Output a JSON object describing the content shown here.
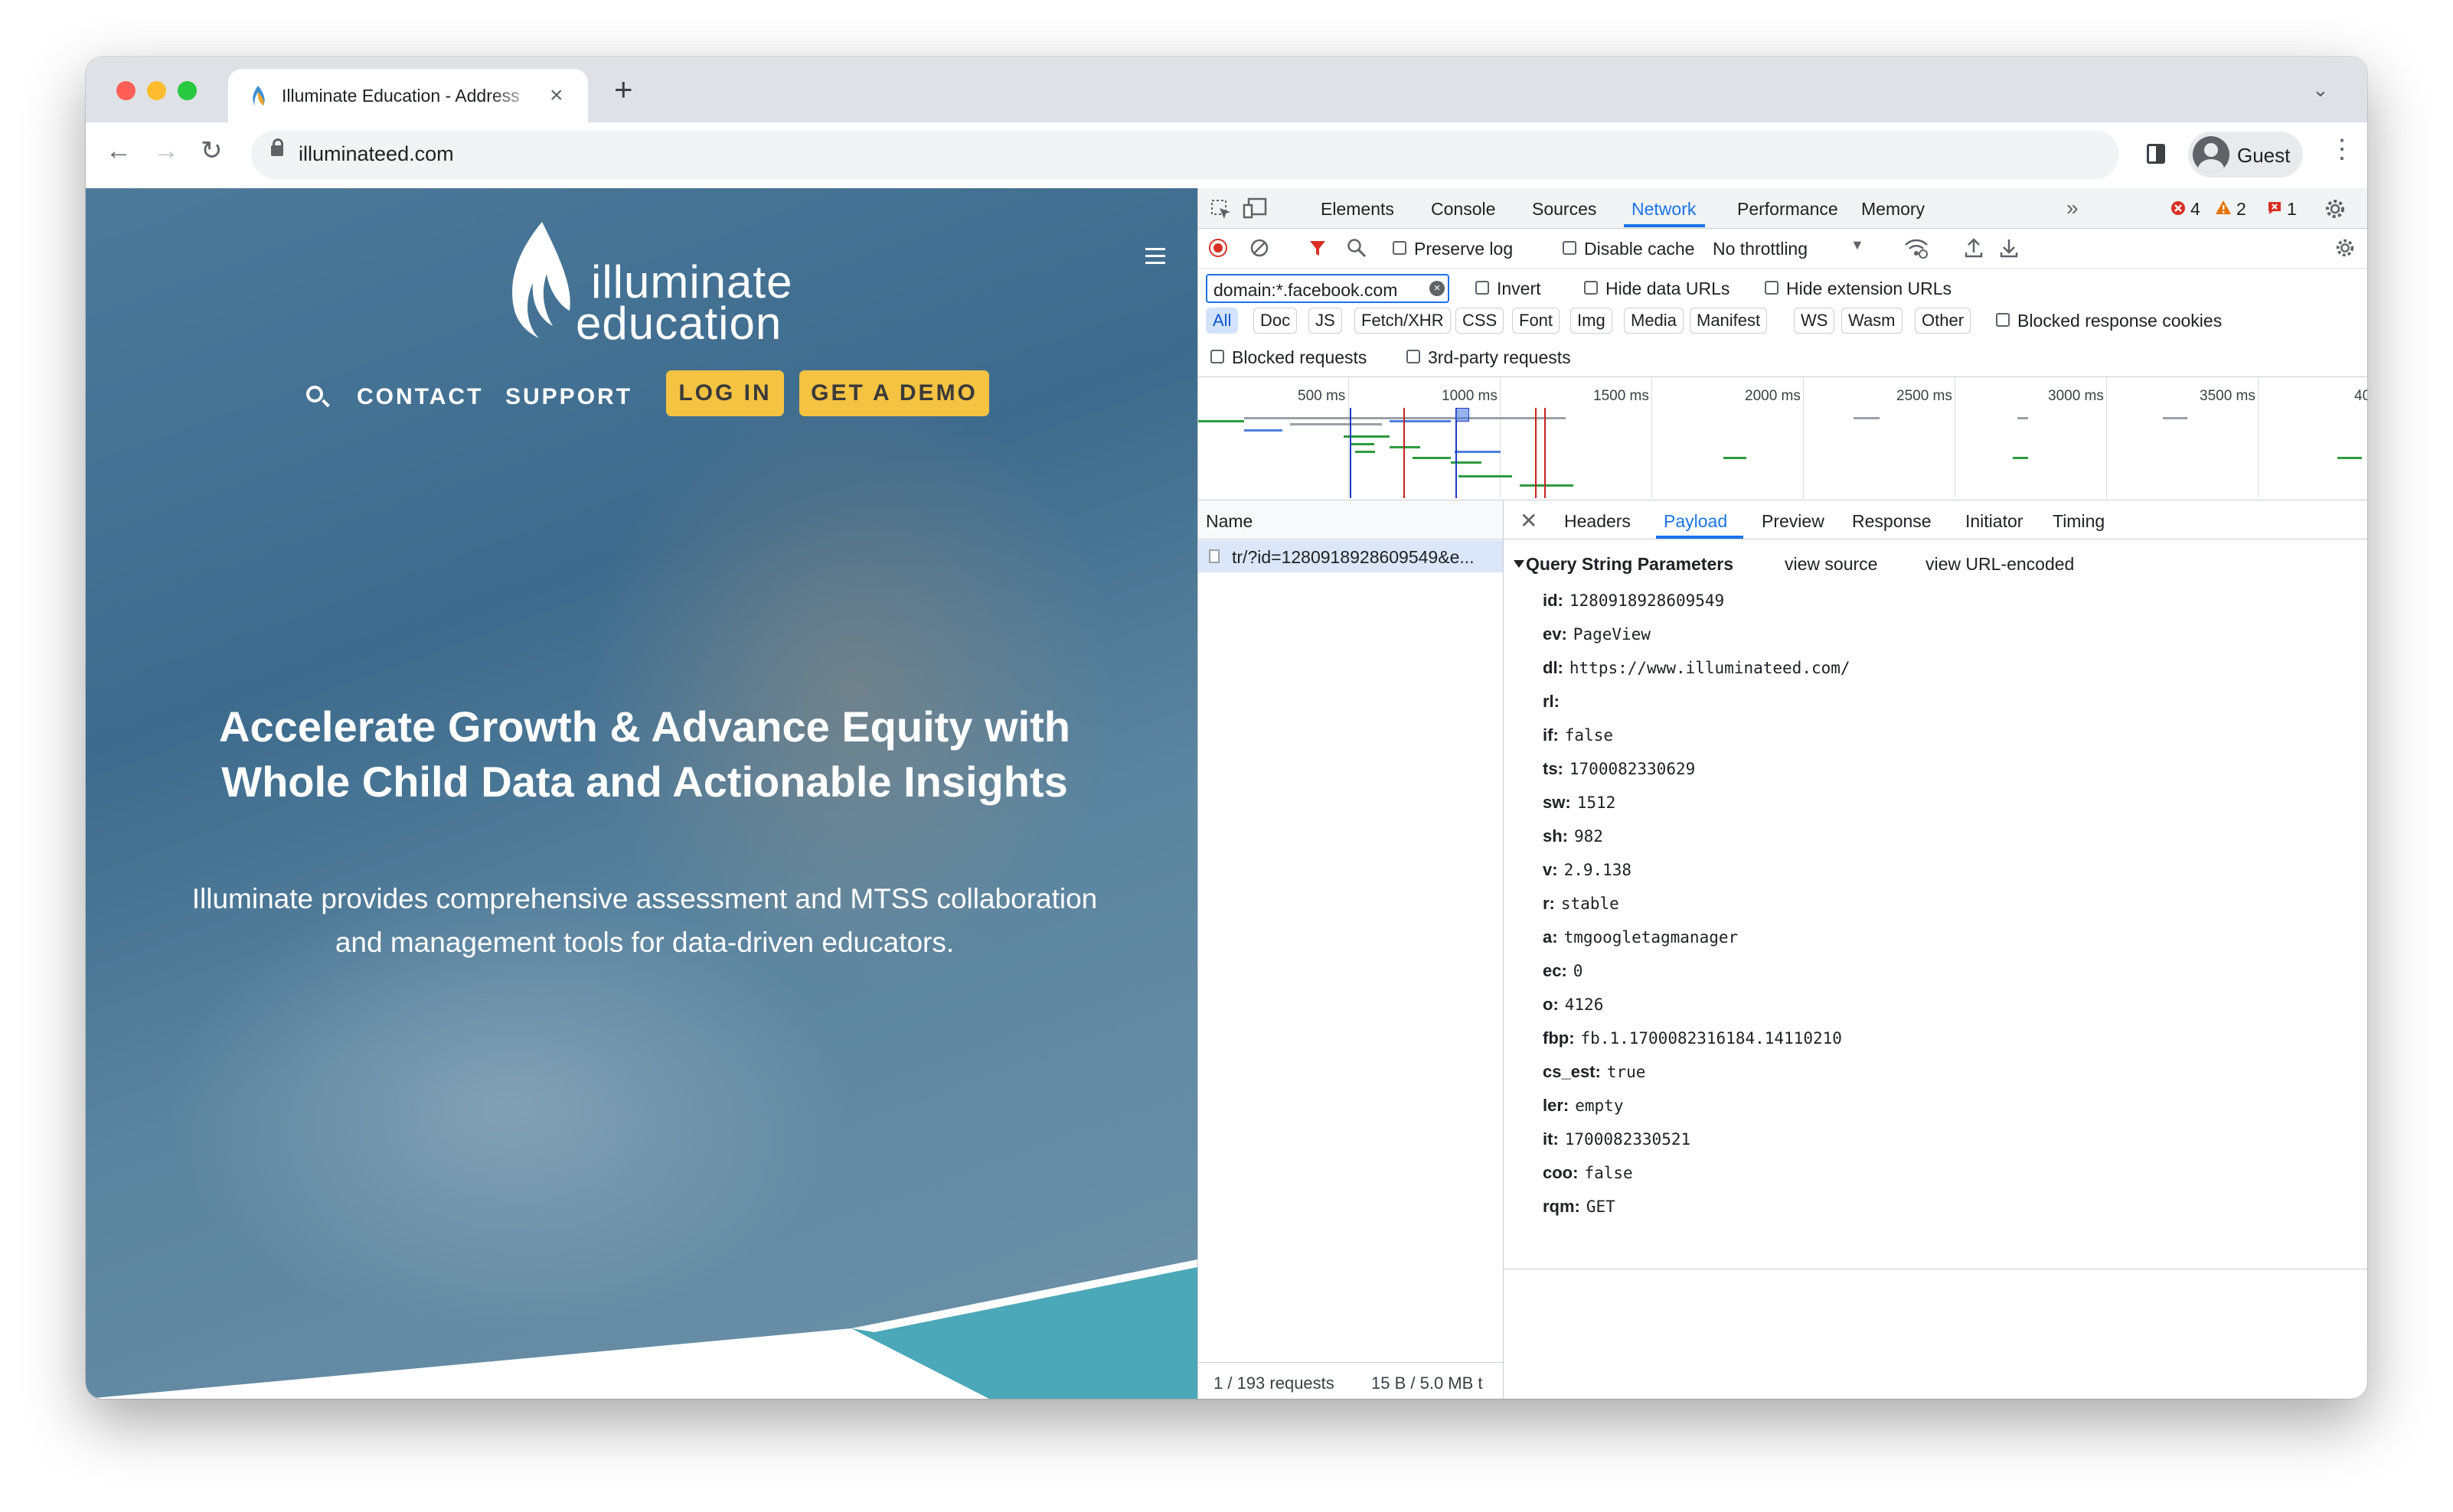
{
  "browser": {
    "tab_title": "Illuminate Education - Address",
    "url": "illuminateed.com",
    "profile_name": "Guest"
  },
  "website": {
    "logo_line1": "illuminate",
    "logo_line2": "education",
    "nav": {
      "contact": "CONTACT",
      "support": "SUPPORT",
      "login": "LOG IN",
      "demo": "GET A DEMO"
    },
    "headline_line1": "Accelerate Growth & Advance Equity with",
    "headline_line2": "Whole Child Data and Actionable Insights",
    "sub_line1": "Illuminate provides comprehensive assessment and MTSS collaboration",
    "sub_line2": "and management tools for data-driven educators.",
    "colors": {
      "accent_yellow": "#f5c342",
      "teal": "#4aa8b8"
    }
  },
  "devtools": {
    "tabs": [
      "Elements",
      "Console",
      "Sources",
      "Network",
      "Performance",
      "Memory"
    ],
    "active_tab": "Network",
    "errors": "4",
    "warnings": "2",
    "issues": "1",
    "toolbar": {
      "preserve_log": "Preserve log",
      "disable_cache": "Disable cache",
      "throttling": "No throttling"
    },
    "filter": {
      "value": "domain:*.facebook.com",
      "invert": "Invert",
      "hide_data_urls": "Hide data URLs",
      "hide_extension_urls": "Hide extension URLs"
    },
    "type_chips": [
      "All",
      "Doc",
      "JS",
      "Fetch/XHR",
      "CSS",
      "Font",
      "Img",
      "Media",
      "Manifest",
      "WS",
      "Wasm",
      "Other"
    ],
    "blocked_response_cookies": "Blocked response cookies",
    "blocked_requests": "Blocked requests",
    "third_party_requests": "3rd-party requests",
    "timeline_ticks": [
      "500 ms",
      "1000 ms",
      "1500 ms",
      "2000 ms",
      "2500 ms",
      "3000 ms",
      "3500 ms",
      "40"
    ],
    "name_header": "Name",
    "request_name": "tr/?id=1280918928609549&e...",
    "status": {
      "requests": "1 / 193 requests",
      "transferred": "15 B / 5.0 MB t"
    },
    "detail_tabs": [
      "Headers",
      "Payload",
      "Preview",
      "Response",
      "Initiator",
      "Timing"
    ],
    "active_detail_tab": "Payload",
    "qsp": {
      "title": "Query String Parameters",
      "view_source": "view source",
      "view_url_encoded": "view URL-encoded",
      "params": [
        {
          "key": "id:",
          "value": "1280918928609549"
        },
        {
          "key": "ev:",
          "value": "PageView"
        },
        {
          "key": "dl:",
          "value": "https://www.illuminateed.com/"
        },
        {
          "key": "rl:",
          "value": ""
        },
        {
          "key": "if:",
          "value": "false"
        },
        {
          "key": "ts:",
          "value": "1700082330629"
        },
        {
          "key": "sw:",
          "value": "1512"
        },
        {
          "key": "sh:",
          "value": "982"
        },
        {
          "key": "v:",
          "value": "2.9.138"
        },
        {
          "key": "r:",
          "value": "stable"
        },
        {
          "key": "a:",
          "value": "tmgoogletagmanager"
        },
        {
          "key": "ec:",
          "value": "0"
        },
        {
          "key": "o:",
          "value": "4126"
        },
        {
          "key": "fbp:",
          "value": "fb.1.1700082316184.14110210"
        },
        {
          "key": "cs_est:",
          "value": "true"
        },
        {
          "key": "ler:",
          "value": "empty"
        },
        {
          "key": "it:",
          "value": "1700082330521"
        },
        {
          "key": "coo:",
          "value": "false"
        },
        {
          "key": "rqm:",
          "value": "GET"
        }
      ]
    }
  }
}
